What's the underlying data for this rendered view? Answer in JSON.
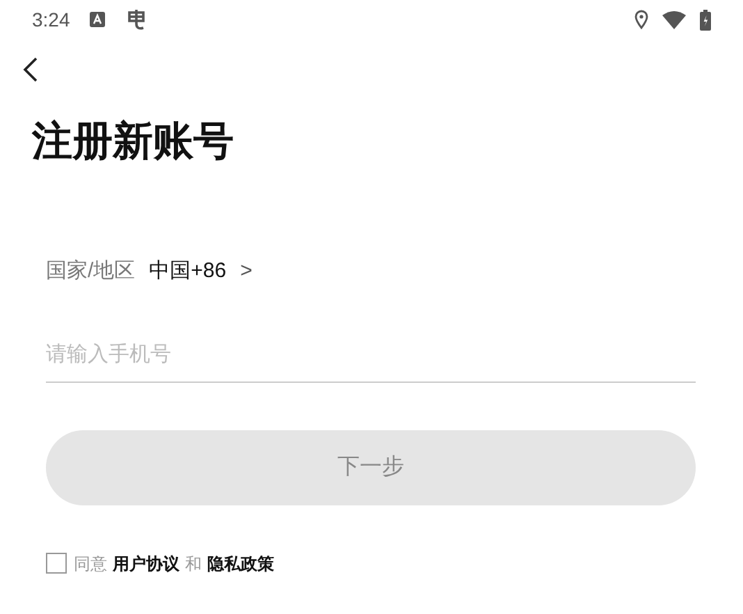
{
  "status_bar": {
    "time": "3:24"
  },
  "title": "注册新账号",
  "country": {
    "label": "国家/地区",
    "value": "中国+86",
    "chevron": ">"
  },
  "phone_field": {
    "placeholder": "请输入手机号"
  },
  "next_button": {
    "label": "下一步",
    "disabled": true
  },
  "agreement": {
    "checked": false,
    "parts": [
      {
        "kind": "plain",
        "text": "同意"
      },
      {
        "kind": "link",
        "text": "用户协议"
      },
      {
        "kind": "plain",
        "text": "和"
      },
      {
        "kind": "link",
        "text": "隐私政策"
      }
    ]
  }
}
